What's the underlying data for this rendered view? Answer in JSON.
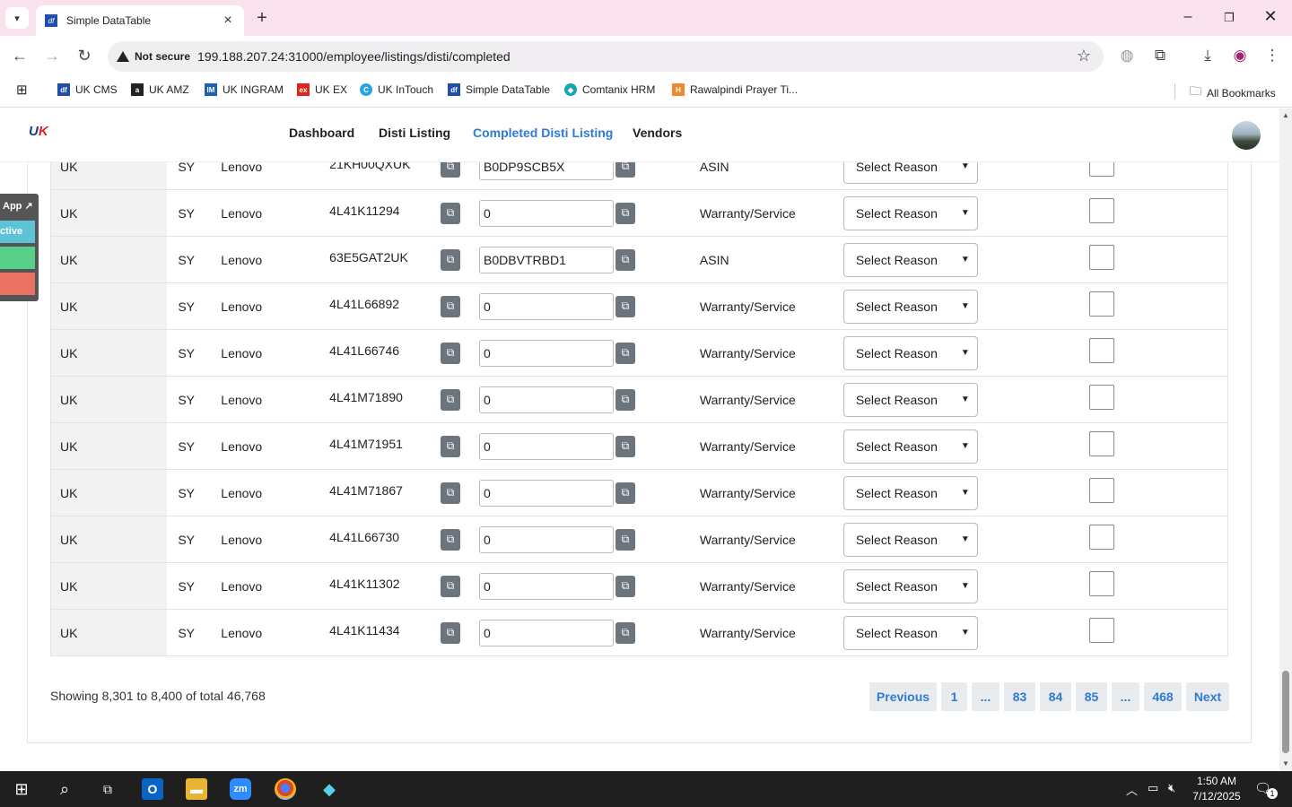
{
  "browser": {
    "tab_title": "Simple DataTable",
    "tab_favicon": "df",
    "security_label": "Not secure",
    "url": "199.188.207.24:31000/employee/listings/disti/completed",
    "bookmarks": [
      {
        "label": "UK CMS",
        "icon": "df",
        "color": "#1f4fa8"
      },
      {
        "label": "UK AMZ",
        "icon": "a",
        "color": "#222222"
      },
      {
        "label": "UK INGRAM",
        "icon": "IM",
        "color": "#1f5fb8"
      },
      {
        "label": "UK EX",
        "icon": "ex",
        "color": "#e2231a"
      },
      {
        "label": "UK InTouch",
        "icon": "C",
        "color": "#2aa4e0"
      },
      {
        "label": "Simple DataTable",
        "icon": "df",
        "color": "#1f4fa8"
      },
      {
        "label": "Comtanix HRM",
        "icon": "◆",
        "color": "#1aa3b8"
      },
      {
        "label": "Rawalpindi Prayer Ti...",
        "icon": "H",
        "color": "#f08a2c"
      }
    ],
    "all_bookmarks_label": "All Bookmarks"
  },
  "nav": {
    "logo_text": "UK",
    "items": [
      "Dashboard",
      "Disti Listing",
      "Completed Disti Listing",
      "Vendors"
    ],
    "active_index": 2
  },
  "side_widget": {
    "app_label": "App ↗",
    "active_label": "ctive"
  },
  "table": {
    "rows": [
      {
        "country": "UK",
        "code": "SY",
        "brand": "Lenovo",
        "part": "21KH00QXUK",
        "value": "B0DP9SCB5X",
        "type": "ASIN",
        "reason": "Select Reason"
      },
      {
        "country": "UK",
        "code": "SY",
        "brand": "Lenovo",
        "part": "4L41K11294",
        "value": "0",
        "type": "Warranty/Service",
        "reason": "Select Reason"
      },
      {
        "country": "UK",
        "code": "SY",
        "brand": "Lenovo",
        "part": "63E5GAT2UK",
        "value": "B0DBVTRBD1",
        "type": "ASIN",
        "reason": "Select Reason"
      },
      {
        "country": "UK",
        "code": "SY",
        "brand": "Lenovo",
        "part": "4L41L66892",
        "value": "0",
        "type": "Warranty/Service",
        "reason": "Select Reason"
      },
      {
        "country": "UK",
        "code": "SY",
        "brand": "Lenovo",
        "part": "4L41L66746",
        "value": "0",
        "type": "Warranty/Service",
        "reason": "Select Reason"
      },
      {
        "country": "UK",
        "code": "SY",
        "brand": "Lenovo",
        "part": "4L41M71890",
        "value": "0",
        "type": "Warranty/Service",
        "reason": "Select Reason"
      },
      {
        "country": "UK",
        "code": "SY",
        "brand": "Lenovo",
        "part": "4L41M71951",
        "value": "0",
        "type": "Warranty/Service",
        "reason": "Select Reason"
      },
      {
        "country": "UK",
        "code": "SY",
        "brand": "Lenovo",
        "part": "4L41M71867",
        "value": "0",
        "type": "Warranty/Service",
        "reason": "Select Reason"
      },
      {
        "country": "UK",
        "code": "SY",
        "brand": "Lenovo",
        "part": "4L41L66730",
        "value": "0",
        "type": "Warranty/Service",
        "reason": "Select Reason"
      },
      {
        "country": "UK",
        "code": "SY",
        "brand": "Lenovo",
        "part": "4L41K11302",
        "value": "0",
        "type": "Warranty/Service",
        "reason": "Select Reason"
      },
      {
        "country": "UK",
        "code": "SY",
        "brand": "Lenovo",
        "part": "4L41K11434",
        "value": "0",
        "type": "Warranty/Service",
        "reason": "Select Reason"
      }
    ]
  },
  "footer": {
    "showing": "Showing 8,301 to 8,400 of total 46,768",
    "pages": [
      "Previous",
      "1",
      "...",
      "83",
      "84",
      "85",
      "...",
      "468",
      "Next"
    ]
  },
  "taskbar": {
    "time": "1:50 AM",
    "date": "7/12/2025",
    "notification_count": "1"
  },
  "colors": {
    "accent": "#2e7bd6",
    "copy_button": "#6c757d",
    "title_bar": "#f9e1ee"
  }
}
